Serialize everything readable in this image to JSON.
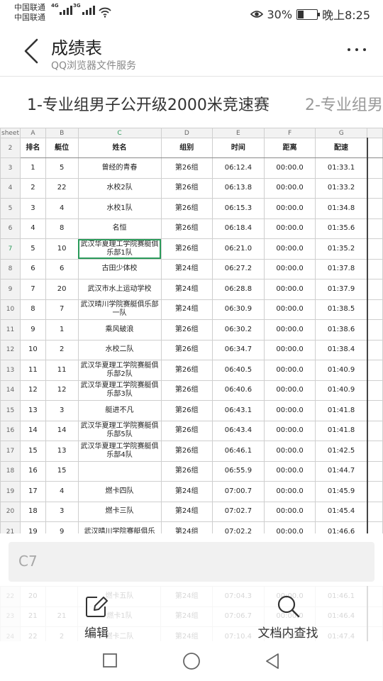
{
  "status_bar": {
    "carrier1": "中国联通",
    "carrier2": "中国联通",
    "net1": "4G",
    "net2": "3G",
    "battery": "30%",
    "battery_level": 0.3,
    "time": "晚上8:25"
  },
  "header": {
    "title": "成绩表",
    "subtitle": "QQ浏览器文件服务"
  },
  "tabs": [
    {
      "label": "1-专业组男子公开级2000米竞速赛"
    },
    {
      "label": "2-专业组男"
    }
  ],
  "sheet": {
    "corner": "sheet",
    "columns": [
      "A",
      "B",
      "C",
      "D",
      "E",
      "F",
      "G"
    ],
    "selected_column": "C",
    "selected_row": "7",
    "header_row_number": "2",
    "headers": [
      "排名",
      "艇位",
      "姓名",
      "组别",
      "时间",
      "距离",
      "配速"
    ],
    "rows": [
      {
        "n": "3",
        "cells": [
          "1",
          "5",
          "曾经的青春",
          "第26组",
          "06:12.4",
          "00:00.0",
          "01:33.1"
        ]
      },
      {
        "n": "4",
        "cells": [
          "2",
          "22",
          "水校2队",
          "第26组",
          "06:13.8",
          "00:00.0",
          "01:33.2"
        ]
      },
      {
        "n": "5",
        "cells": [
          "3",
          "4",
          "水校1队",
          "第26组",
          "06:15.3",
          "00:00.0",
          "01:34.8"
        ]
      },
      {
        "n": "6",
        "cells": [
          "4",
          "8",
          "名恒",
          "第26组",
          "06:18.4",
          "00:00.0",
          "01:35.6"
        ]
      },
      {
        "n": "7",
        "cells": [
          "5",
          "10",
          "武汉华夏理工学院赛艇俱乐部1队",
          "第26组",
          "06:21.0",
          "00:00.0",
          "01:35.2"
        ]
      },
      {
        "n": "8",
        "cells": [
          "6",
          "6",
          "古田少体校",
          "第24组",
          "06:27.2",
          "00:00.0",
          "01:37.8"
        ]
      },
      {
        "n": "9",
        "cells": [
          "7",
          "20",
          "武汉市水上运动学校",
          "第24组",
          "06:28.8",
          "00:00.0",
          "01:37.9"
        ]
      },
      {
        "n": "10",
        "cells": [
          "8",
          "7",
          "武汉晴川学院赛艇俱乐部一队",
          "第24组",
          "06:30.9",
          "00:00.0",
          "01:38.5"
        ]
      },
      {
        "n": "11",
        "cells": [
          "9",
          "1",
          "乘风破浪",
          "第26组",
          "06:30.2",
          "00:00.0",
          "01:38.6"
        ]
      },
      {
        "n": "12",
        "cells": [
          "10",
          "2",
          "水校二队",
          "第26组",
          "06:34.7",
          "00:00.0",
          "01:38.4"
        ]
      },
      {
        "n": "13",
        "cells": [
          "11",
          "11",
          "武汉华夏理工学院赛艇俱乐部2队",
          "第26组",
          "06:40.5",
          "00:00.0",
          "01:40.9"
        ]
      },
      {
        "n": "14",
        "cells": [
          "12",
          "12",
          "武汉华夏理工学院赛艇俱乐部3队",
          "第26组",
          "06:40.6",
          "00:00.0",
          "01:40.9"
        ]
      },
      {
        "n": "15",
        "cells": [
          "13",
          "3",
          "艇进不凡",
          "第26组",
          "06:43.1",
          "00:00.0",
          "01:41.8"
        ]
      },
      {
        "n": "16",
        "cells": [
          "14",
          "14",
          "武汉华夏理工学院赛艇俱乐部5队",
          "第26组",
          "06:43.4",
          "00:00.0",
          "01:41.8"
        ]
      },
      {
        "n": "17",
        "cells": [
          "15",
          "13",
          "武汉华夏理工学院赛艇俱乐部4队",
          "第26组",
          "06:46.1",
          "00:00.0",
          "01:42.5"
        ]
      },
      {
        "n": "18",
        "cells": [
          "16",
          "15",
          "",
          "第26组",
          "06:55.9",
          "00:00.0",
          "01:44.7"
        ]
      },
      {
        "n": "19",
        "cells": [
          "17",
          "4",
          "燃卡四队",
          "第24组",
          "07:00.7",
          "00:00.0",
          "01:45.9"
        ]
      },
      {
        "n": "20",
        "cells": [
          "18",
          "3",
          "燃卡三队",
          "第24组",
          "07:02.7",
          "00:00.0",
          "01:45.4"
        ]
      },
      {
        "n": "21",
        "cells": [
          "19",
          "9",
          "武汉晴川学院赛艇俱乐",
          "第24组",
          "07:02.2",
          "00:00.0",
          "01:46.6"
        ]
      }
    ],
    "ghost_rows": [
      {
        "n": "22",
        "cells": [
          "20",
          "",
          "燃卡五队",
          "第24组",
          "07:04.3",
          "00:00.0",
          "01:46.1"
        ]
      },
      {
        "n": "23",
        "cells": [
          "21",
          "21",
          "燃卡1队",
          "第24组",
          "07:06.7",
          "00:00.0",
          "01:46.4"
        ]
      },
      {
        "n": "24",
        "cells": [
          "22",
          "2",
          "燃卡二队",
          "第24组",
          "07:10.4",
          "00:00.0",
          "01:47.4"
        ]
      }
    ]
  },
  "cell_ref": "C7",
  "toolbar": {
    "edit_label": "编辑",
    "find_label": "文档内查找"
  }
}
